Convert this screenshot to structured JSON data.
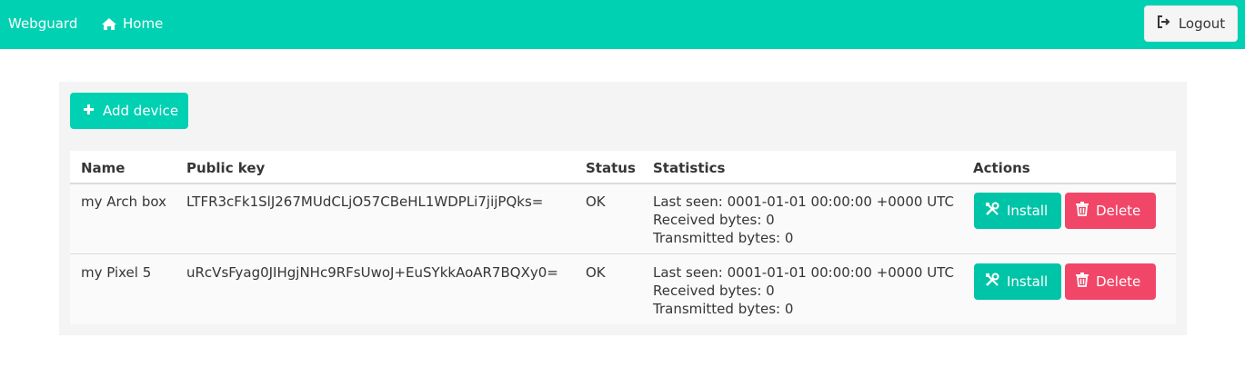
{
  "navbar": {
    "brand": "Webguard",
    "home_label": "Home",
    "logout_label": "Logout"
  },
  "toolbar": {
    "add_device_label": "Add device"
  },
  "table": {
    "headers": {
      "name": "Name",
      "public_key": "Public key",
      "status": "Status",
      "statistics": "Statistics",
      "actions": "Actions"
    },
    "rows": [
      {
        "name": "my Arch box",
        "public_key": "LTFR3cFk1SlJ267MUdCLjO57CBeHL1WDPLi7jijPQks=",
        "status": "OK",
        "last_seen": "Last seen: 0001-01-01 00:00:00 +0000 UTC",
        "received": "Received bytes: 0",
        "transmitted": "Transmitted bytes: 0",
        "install_label": "Install",
        "delete_label": "Delete"
      },
      {
        "name": "my Pixel 5",
        "public_key": "uRcVsFyag0JIHgjNHc9RFsUwoJ+EuSYkkAoAR7BQXy0=",
        "status": "OK",
        "last_seen": "Last seen: 0001-01-01 00:00:00 +0000 UTC",
        "received": "Received bytes: 0",
        "transmitted": "Transmitted bytes: 0",
        "install_label": "Install",
        "delete_label": "Delete"
      }
    ]
  },
  "colors": {
    "primary": "#00d1b2",
    "danger": "#f14668",
    "panel_bg": "#f4f4f4"
  },
  "icons": {
    "home": "home-icon",
    "logout": "sign-out-icon",
    "add": "plus-icon",
    "install": "tools-icon",
    "delete": "trash-icon"
  }
}
